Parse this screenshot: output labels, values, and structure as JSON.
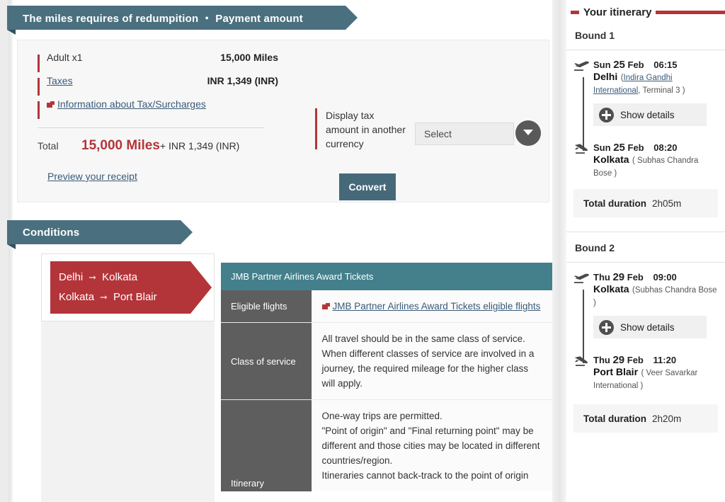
{
  "payment_section": {
    "banner_title": "The miles requires of redumpition ・ Payment amount",
    "rows": [
      {
        "label": "Adult x1",
        "value": "15,000 Miles",
        "is_link": false
      },
      {
        "label": "Taxes",
        "value": "INR 1,349 (INR)",
        "is_link": true
      }
    ],
    "tax_info_link": "Information about Tax/Surcharges",
    "total_label": "Total",
    "total_miles": "15,000 Miles",
    "total_rest": "+ INR 1,349 (INR)",
    "receipt_link": "Preview your receipt",
    "convert": {
      "label": "Display tax amount in another currency",
      "select_value": "Select",
      "button_label": "Convert"
    }
  },
  "conditions_section": {
    "banner_title": "Conditions",
    "routes": [
      {
        "from": "Delhi",
        "to": "Kolkata"
      },
      {
        "from": "Kolkata",
        "to": "Port Blair"
      }
    ],
    "table": {
      "header": "JMB Partner Airlines Award Tickets",
      "rows": [
        {
          "key": "Eligible flights",
          "link": "JMB Partner Airlines Award Tickets eligible flights",
          "value": ""
        },
        {
          "key": "Class of service",
          "link": "",
          "value": "All travel should be in the same class of service. When different classes of service are involved in a journey, the required mileage for the higher class will apply."
        },
        {
          "key": "Itinerary",
          "link": "",
          "value": "One-way trips are permitted.\n\"Point of origin\" and \"Final returning point\" may be different and those cities may be located in different countries/region.\nItineraries cannot back-track to the point of origin"
        }
      ]
    }
  },
  "itinerary": {
    "title": "Your itinerary",
    "bounds": [
      {
        "heading": "Bound 1",
        "segments": [
          {
            "icon": "plane-takeoff-icon",
            "date_prefix": "Sun",
            "day": "25",
            "month": "Feb",
            "time": "06:15",
            "city": "Delhi",
            "airport_prefix": "(",
            "airport_link": "Indira Gandhi International",
            "airport_suffix": ", Terminal 3 )",
            "has_details": true,
            "details_label": "Show details"
          },
          {
            "icon": "plane-landing-icon",
            "date_prefix": "Sun",
            "day": "25",
            "month": "Feb",
            "time": "08:20",
            "city": "Kolkata",
            "airport_prefix": "( Subhas Chandra Bose )",
            "airport_link": "",
            "airport_suffix": "",
            "has_details": false,
            "details_label": ""
          }
        ],
        "duration_label": "Total duration",
        "duration_value": "2h05m"
      },
      {
        "heading": "Bound 2",
        "segments": [
          {
            "icon": "plane-takeoff-icon",
            "date_prefix": "Thu",
            "day": "29",
            "month": "Feb",
            "time": "09:00",
            "city": "Kolkata",
            "airport_prefix": "(Subhas Chandra Bose )",
            "airport_link": "",
            "airport_suffix": "",
            "has_details": true,
            "details_label": "Show details"
          },
          {
            "icon": "plane-landing-icon",
            "date_prefix": "Thu",
            "day": "29",
            "month": "Feb",
            "time": "11:20",
            "city": "Port Blair",
            "airport_prefix": "( Veer Savarkar International )",
            "airport_link": "",
            "airport_suffix": "",
            "has_details": false,
            "details_label": ""
          }
        ],
        "duration_label": "Total duration",
        "duration_value": "2h20m"
      }
    ]
  },
  "colors": {
    "banner_teal": "#4a707f",
    "table_header_teal": "#43808c",
    "accent_red": "#b3353a",
    "key_cell_gray": "#5e5e5e",
    "convert_button": "#46697a"
  }
}
